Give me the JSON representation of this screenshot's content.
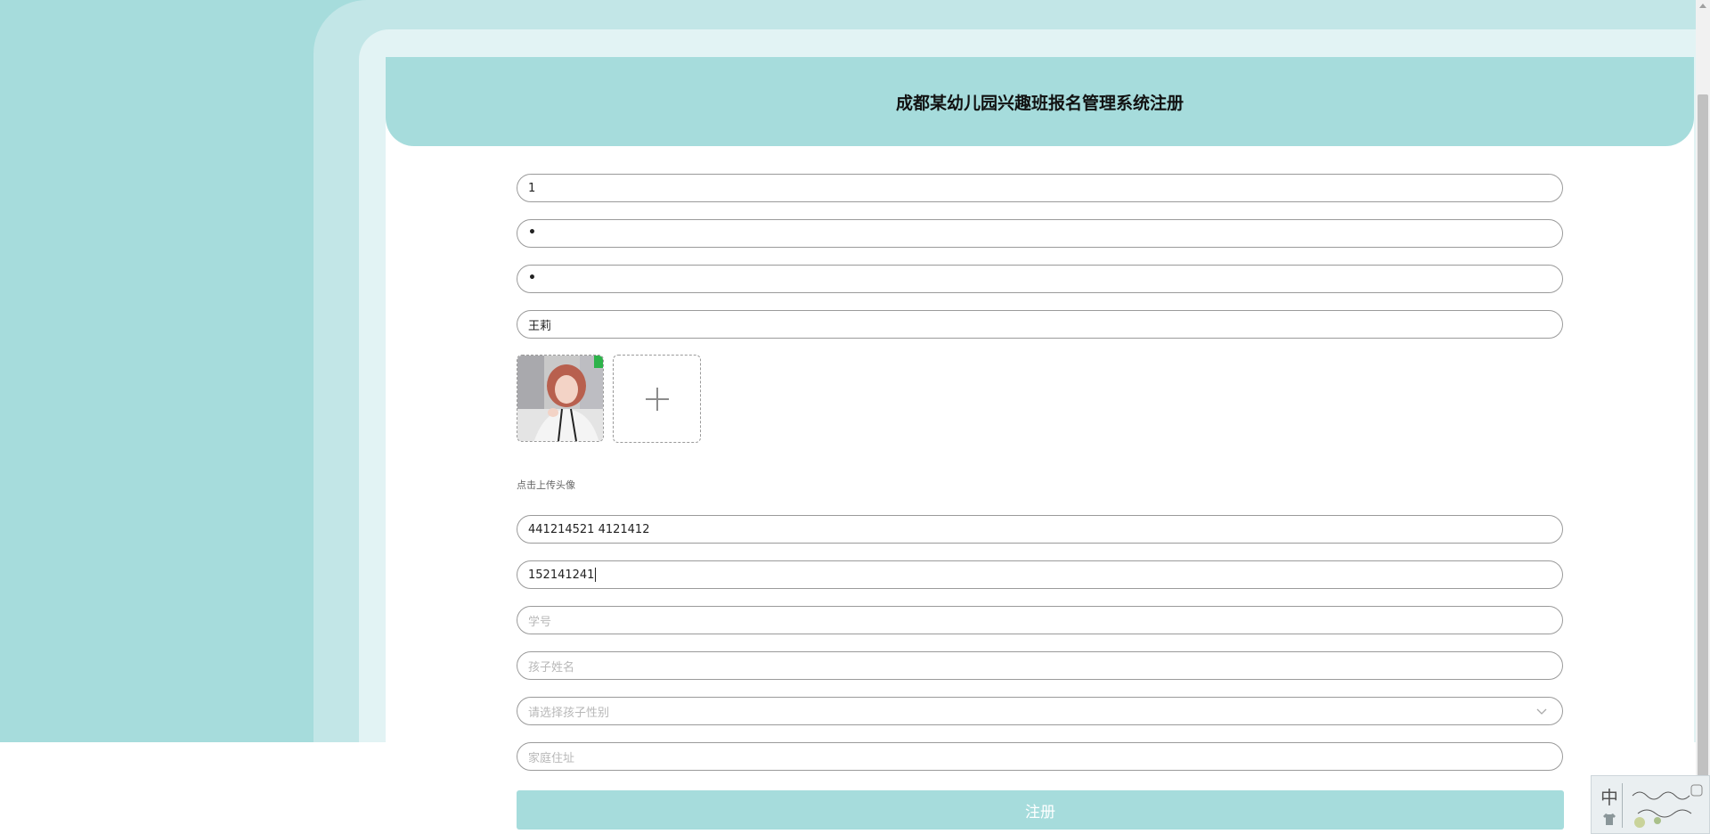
{
  "header": {
    "title": "成都某幼儿园兴趣班报名管理系统注册"
  },
  "form": {
    "account": {
      "value": "1"
    },
    "password": {
      "value": "•"
    },
    "confirm_password": {
      "value": "•"
    },
    "name": {
      "value": "王莉"
    },
    "avatar": {
      "hint": "点击上传头像"
    },
    "id_number": {
      "value": "441214521 4121412"
    },
    "phone": {
      "value": "152141241"
    },
    "student_no": {
      "placeholder": "学号"
    },
    "child_name": {
      "placeholder": "孩子姓名"
    },
    "child_gender": {
      "placeholder": "请选择孩子性别"
    },
    "address": {
      "placeholder": "家庭住址"
    },
    "submit_label": "注册"
  },
  "ime": {
    "mode_label": "中"
  },
  "colors": {
    "teal": "#a6dcdc",
    "teal_light": "#c2e6e7",
    "teal_lighter": "#e2f3f4"
  }
}
